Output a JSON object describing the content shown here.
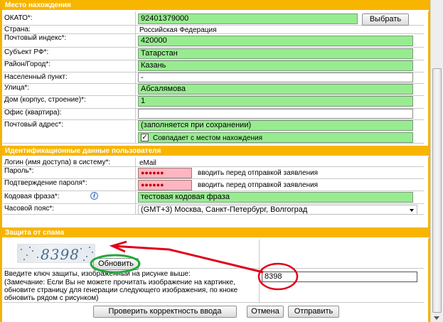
{
  "sections": {
    "location": "Место нахождения",
    "identification": "Идентификационные данные пользователя",
    "spam": "Защита от спама"
  },
  "location": {
    "okato_label": "ОКАТО*:",
    "okato_value": "92401379000",
    "select_button": "Выбрать",
    "country_label": "Страна:",
    "country_value": "Российская Федерация",
    "postcode_label": "Почтовый индекс*:",
    "postcode_value": "420000",
    "subject_label": "Субъект РФ*:",
    "subject_value": "Татарстан",
    "district_label": "Район/Город*:",
    "district_value": "Казань",
    "settlement_label": "Населенный пункт:",
    "settlement_value": "-",
    "street_label": "Улица*:",
    "street_value": "Абсалямова",
    "house_label": "Дом (корпус, строение)*:",
    "house_value": "1",
    "office_label": "Офис (квартира):",
    "office_value": "",
    "postal_address_label": "Почтовый адрес*:",
    "postal_address_value": "(заполняется при сохранении)",
    "same_as_location_label": "Совпадает с местом нахождения",
    "same_as_location_checked": true
  },
  "identification": {
    "login_label": "Логин (имя доступа) в систему*:",
    "login_value": "eMail",
    "password_label": "Пароль*:",
    "password_value": "●●●●●●",
    "password_hint": "вводить перед отправкой заявления",
    "confirm_label": "Подтверждение пароля*:",
    "confirm_value": "●●●●●●",
    "confirm_hint": "вводить перед отправкой заявления",
    "codeword_label": "Кодовая фраза*:",
    "codeword_value": "тестовая кодовая фраза",
    "timezone_label": "Часовой пояс*:",
    "timezone_value": "(GMT+3) Москва, Санкт-Петербург, Волгоград"
  },
  "spam": {
    "captcha_digits": "8398",
    "refresh_button": "Обновить",
    "key_label": "Введите ключ защиты, изображенный на рисунке выше:",
    "key_note": "(Замечание: Если Вы не можете прочитать изображение на картинке, обновите страницу для генерации следующего изображения, по кноке обновить рядом с рисунком)",
    "key_value": "8398"
  },
  "actions": {
    "validate": "Проверить корректность ввода",
    "cancel": "Отмена",
    "submit": "Отправить"
  },
  "colors": {
    "section_header": "#f7b500",
    "required_field": "#98ec90",
    "password_field": "#ffb6c1",
    "annotation_red": "#e0001a",
    "annotation_green": "#21a83a"
  }
}
